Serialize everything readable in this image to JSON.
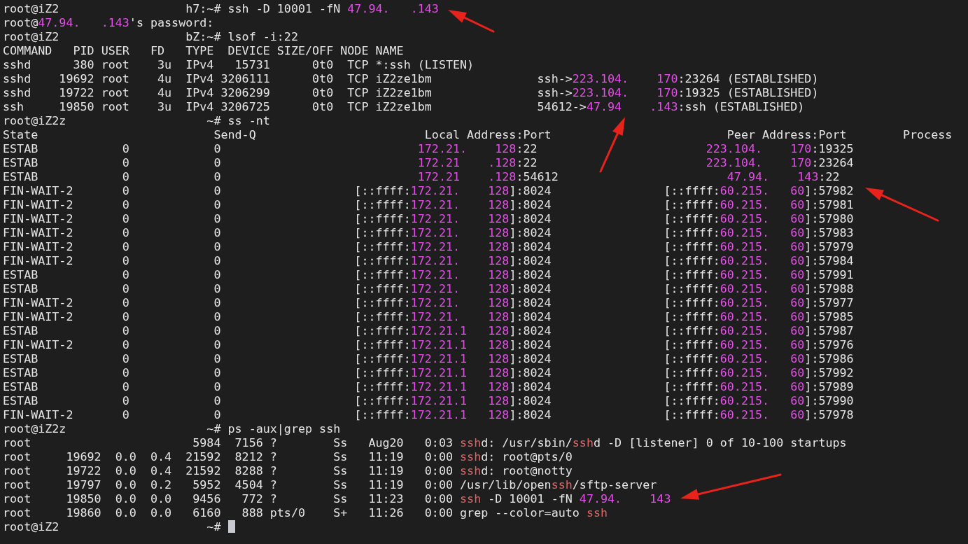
{
  "terminal": {
    "lines": [
      {
        "segments": [
          {
            "text": "root@iZ2                  h7:~# ssh -D 10001 -fN ",
            "kind": "plain"
          },
          {
            "text": "47.94.   .143",
            "kind": "ip"
          }
        ]
      },
      {
        "segments": [
          {
            "text": "root@",
            "kind": "plain"
          },
          {
            "text": "47.94.   .143",
            "kind": "ip"
          },
          {
            "text": "'s password:",
            "kind": "plain"
          }
        ]
      },
      {
        "segments": [
          {
            "text": "root@iZ2                  bZ:~# lsof -i:22",
            "kind": "plain"
          }
        ]
      },
      {
        "segments": [
          {
            "text": "COMMAND   PID USER   FD   TYPE  DEVICE SIZE/OFF NODE NAME",
            "kind": "plain"
          }
        ]
      },
      {
        "segments": [
          {
            "text": "sshd      380 root    3u  IPv4   15731      0t0  TCP *:ssh (LISTEN)",
            "kind": "plain"
          }
        ]
      },
      {
        "segments": [
          {
            "text": "sshd    19692 root    4u  IPv4 3206111      0t0  TCP iZ2ze1bm               ssh->",
            "kind": "plain"
          },
          {
            "text": "223.104.    170",
            "kind": "ip"
          },
          {
            "text": ":23264 (ESTABLISHED)",
            "kind": "plain"
          }
        ]
      },
      {
        "segments": [
          {
            "text": "sshd    19722 root    4u  IPv4 3206299      0t0  TCP iZ2ze1bm               ssh->",
            "kind": "plain"
          },
          {
            "text": "223.104.    170",
            "kind": "ip"
          },
          {
            "text": ":19325 (ESTABLISHED)",
            "kind": "plain"
          }
        ]
      },
      {
        "segments": [
          {
            "text": "ssh     19850 root    3u  IPv4 3206725      0t0  TCP iZ2ze1bm               54612->",
            "kind": "plain"
          },
          {
            "text": "47.94    .143",
            "kind": "ip"
          },
          {
            "text": ":ssh (ESTABLISHED)",
            "kind": "plain"
          }
        ]
      },
      {
        "segments": [
          {
            "text": "root@iZ2z                    ~# ss -nt",
            "kind": "plain"
          }
        ]
      },
      {
        "segments": [
          {
            "text": "State                         Send-Q                        Local Address:Port                         Peer Address:Port        Process",
            "kind": "plain"
          }
        ]
      },
      {
        "segments": [
          {
            "text": "ESTAB            0            0                            ",
            "kind": "plain"
          },
          {
            "text": "172.21.    128",
            "kind": "ip"
          },
          {
            "text": ":22                        ",
            "kind": "plain"
          },
          {
            "text": "223.104.    170",
            "kind": "ip"
          },
          {
            "text": ":19325",
            "kind": "plain"
          }
        ]
      },
      {
        "segments": [
          {
            "text": "ESTAB            0            0                            ",
            "kind": "plain"
          },
          {
            "text": "172.21    .128",
            "kind": "ip"
          },
          {
            "text": ":22                        ",
            "kind": "plain"
          },
          {
            "text": "223.104.    170",
            "kind": "ip"
          },
          {
            "text": ":23264",
            "kind": "plain"
          }
        ]
      },
      {
        "segments": [
          {
            "text": "ESTAB            0            0                            ",
            "kind": "plain"
          },
          {
            "text": "172.21    .128",
            "kind": "ip"
          },
          {
            "text": ":54612                        ",
            "kind": "plain"
          },
          {
            "text": "47.94.    143",
            "kind": "ip"
          },
          {
            "text": ":22",
            "kind": "plain"
          }
        ]
      },
      {
        "segments": [
          {
            "text": "FIN-WAIT-2       0            0                   [::ffff:",
            "kind": "plain"
          },
          {
            "text": "172.21.    128",
            "kind": "ip"
          },
          {
            "text": "]:8024                [::ffff:",
            "kind": "plain"
          },
          {
            "text": "60.215.   60",
            "kind": "ip"
          },
          {
            "text": "]:57982",
            "kind": "plain"
          }
        ]
      },
      {
        "segments": [
          {
            "text": "FIN-WAIT-2       0            0                   [::ffff:",
            "kind": "plain"
          },
          {
            "text": "172.21.    128",
            "kind": "ip"
          },
          {
            "text": "]:8024                [::ffff:",
            "kind": "plain"
          },
          {
            "text": "60.215.   60",
            "kind": "ip"
          },
          {
            "text": "]:57981",
            "kind": "plain"
          }
        ]
      },
      {
        "segments": [
          {
            "text": "FIN-WAIT-2       0            0                   [::ffff:",
            "kind": "plain"
          },
          {
            "text": "172.21.    128",
            "kind": "ip"
          },
          {
            "text": "]:8024                [::ffff:",
            "kind": "plain"
          },
          {
            "text": "60.215.   60",
            "kind": "ip"
          },
          {
            "text": "]:57980",
            "kind": "plain"
          }
        ]
      },
      {
        "segments": [
          {
            "text": "FIN-WAIT-2       0            0                   [::ffff:",
            "kind": "plain"
          },
          {
            "text": "172.21.    128",
            "kind": "ip"
          },
          {
            "text": "]:8024                [::ffff:",
            "kind": "plain"
          },
          {
            "text": "60.215.   60",
            "kind": "ip"
          },
          {
            "text": "]:57983",
            "kind": "plain"
          }
        ]
      },
      {
        "segments": [
          {
            "text": "FIN-WAIT-2       0            0                   [::ffff:",
            "kind": "plain"
          },
          {
            "text": "172.21.    128",
            "kind": "ip"
          },
          {
            "text": "]:8024                [::ffff:",
            "kind": "plain"
          },
          {
            "text": "60.215.   60",
            "kind": "ip"
          },
          {
            "text": "]:57979",
            "kind": "plain"
          }
        ]
      },
      {
        "segments": [
          {
            "text": "FIN-WAIT-2       0            0                   [::ffff:",
            "kind": "plain"
          },
          {
            "text": "172.21.    128",
            "kind": "ip"
          },
          {
            "text": "]:8024                [::ffff:",
            "kind": "plain"
          },
          {
            "text": "60.215.   60",
            "kind": "ip"
          },
          {
            "text": "]:57984",
            "kind": "plain"
          }
        ]
      },
      {
        "segments": [
          {
            "text": "ESTAB            0            0                   [::ffff:",
            "kind": "plain"
          },
          {
            "text": "172.21.    128",
            "kind": "ip"
          },
          {
            "text": "]:8024                [::ffff:",
            "kind": "plain"
          },
          {
            "text": "60.215.   60",
            "kind": "ip"
          },
          {
            "text": "]:57991",
            "kind": "plain"
          }
        ]
      },
      {
        "segments": [
          {
            "text": "ESTAB            0            0                   [::ffff:",
            "kind": "plain"
          },
          {
            "text": "172.21.    128",
            "kind": "ip"
          },
          {
            "text": "]:8024                [::ffff:",
            "kind": "plain"
          },
          {
            "text": "60.215.   60",
            "kind": "ip"
          },
          {
            "text": "]:57988",
            "kind": "plain"
          }
        ]
      },
      {
        "segments": [
          {
            "text": "FIN-WAIT-2       0            0                   [::ffff:",
            "kind": "plain"
          },
          {
            "text": "172.21.    128",
            "kind": "ip"
          },
          {
            "text": "]:8024                [::ffff:",
            "kind": "plain"
          },
          {
            "text": "60.215.   60",
            "kind": "ip"
          },
          {
            "text": "]:57977",
            "kind": "plain"
          }
        ]
      },
      {
        "segments": [
          {
            "text": "FIN-WAIT-2       0            0                   [::ffff:",
            "kind": "plain"
          },
          {
            "text": "172.21.    128",
            "kind": "ip"
          },
          {
            "text": "]:8024                [::ffff:",
            "kind": "plain"
          },
          {
            "text": "60.215.   60",
            "kind": "ip"
          },
          {
            "text": "]:57985",
            "kind": "plain"
          }
        ]
      },
      {
        "segments": [
          {
            "text": "ESTAB            0            0                   [::ffff:",
            "kind": "plain"
          },
          {
            "text": "172.21.1   128",
            "kind": "ip"
          },
          {
            "text": "]:8024                [::ffff:",
            "kind": "plain"
          },
          {
            "text": "60.215.   60",
            "kind": "ip"
          },
          {
            "text": "]:57987",
            "kind": "plain"
          }
        ]
      },
      {
        "segments": [
          {
            "text": "FIN-WAIT-2       0            0                   [::ffff:",
            "kind": "plain"
          },
          {
            "text": "172.21.1   128",
            "kind": "ip"
          },
          {
            "text": "]:8024                [::ffff:",
            "kind": "plain"
          },
          {
            "text": "60.215.   60",
            "kind": "ip"
          },
          {
            "text": "]:57976",
            "kind": "plain"
          }
        ]
      },
      {
        "segments": [
          {
            "text": "ESTAB            0            0                   [::ffff:",
            "kind": "plain"
          },
          {
            "text": "172.21.1   128",
            "kind": "ip"
          },
          {
            "text": "]:8024                [::ffff:",
            "kind": "plain"
          },
          {
            "text": "60.215.   60",
            "kind": "ip"
          },
          {
            "text": "]:57986",
            "kind": "plain"
          }
        ]
      },
      {
        "segments": [
          {
            "text": "ESTAB            0            0                   [::ffff:",
            "kind": "plain"
          },
          {
            "text": "172.21.1   128",
            "kind": "ip"
          },
          {
            "text": "]:8024                [::ffff:",
            "kind": "plain"
          },
          {
            "text": "60.215.   60",
            "kind": "ip"
          },
          {
            "text": "]:57992",
            "kind": "plain"
          }
        ]
      },
      {
        "segments": [
          {
            "text": "ESTAB            0            0                   [::ffff:",
            "kind": "plain"
          },
          {
            "text": "172.21.1   128",
            "kind": "ip"
          },
          {
            "text": "]:8024                [::ffff:",
            "kind": "plain"
          },
          {
            "text": "60.215.   60",
            "kind": "ip"
          },
          {
            "text": "]:57989",
            "kind": "plain"
          }
        ]
      },
      {
        "segments": [
          {
            "text": "ESTAB            0            0                   [::ffff:",
            "kind": "plain"
          },
          {
            "text": "172.21.1   128",
            "kind": "ip"
          },
          {
            "text": "]:8024                [::ffff:",
            "kind": "plain"
          },
          {
            "text": "60.215.   60",
            "kind": "ip"
          },
          {
            "text": "]:57990",
            "kind": "plain"
          }
        ]
      },
      {
        "segments": [
          {
            "text": "FIN-WAIT-2       0            0                   [::ffff:",
            "kind": "plain"
          },
          {
            "text": "172.21.1   128",
            "kind": "ip"
          },
          {
            "text": "]:8024                [::ffff:",
            "kind": "plain"
          },
          {
            "text": "60.215.   60",
            "kind": "ip"
          },
          {
            "text": "]:57978",
            "kind": "plain"
          }
        ]
      },
      {
        "segments": [
          {
            "text": "root@iZ2z                    ~# ps -aux|grep ssh",
            "kind": "plain"
          }
        ]
      },
      {
        "segments": [
          {
            "text": "root                       5984  7156 ?        Ss   Aug20   0:03 ",
            "kind": "plain"
          },
          {
            "text": "ssh",
            "kind": "match"
          },
          {
            "text": "d: /usr/sbin/",
            "kind": "plain"
          },
          {
            "text": "ssh",
            "kind": "match"
          },
          {
            "text": "d -D [listener] 0 of 10-100 startups",
            "kind": "plain"
          }
        ]
      },
      {
        "segments": [
          {
            "text": "root     19692  0.0  0.4  21592  8212 ?        Ss   11:19   0:00 ",
            "kind": "plain"
          },
          {
            "text": "ssh",
            "kind": "match"
          },
          {
            "text": "d: root@pts/0",
            "kind": "plain"
          }
        ]
      },
      {
        "segments": [
          {
            "text": "root     19722  0.0  0.4  21592  8288 ?        Ss   11:19   0:00 ",
            "kind": "plain"
          },
          {
            "text": "ssh",
            "kind": "match"
          },
          {
            "text": "d: root@notty",
            "kind": "plain"
          }
        ]
      },
      {
        "segments": [
          {
            "text": "root     19797  0.0  0.2   5952  4504 ?        Ss   11:19   0:00 /usr/lib/open",
            "kind": "plain"
          },
          {
            "text": "ssh",
            "kind": "match"
          },
          {
            "text": "/sftp-server",
            "kind": "plain"
          }
        ]
      },
      {
        "segments": [
          {
            "text": "root     19850  0.0  0.0   9456   772 ?        Ss   11:23   0:00 ",
            "kind": "plain"
          },
          {
            "text": "ssh",
            "kind": "match"
          },
          {
            "text": " -D 10001 -fN ",
            "kind": "plain"
          },
          {
            "text": "47.94.    143",
            "kind": "ip"
          }
        ]
      },
      {
        "segments": [
          {
            "text": "root     19860  0.0  0.0   6160   888 pts/0    S+   11:26   0:00 grep --color=auto ",
            "kind": "plain"
          },
          {
            "text": "ssh",
            "kind": "match"
          }
        ]
      },
      {
        "segments": [
          {
            "text": "root@iZ2                     ~# ",
            "kind": "plain"
          },
          {
            "kind": "cursor"
          }
        ]
      }
    ]
  }
}
